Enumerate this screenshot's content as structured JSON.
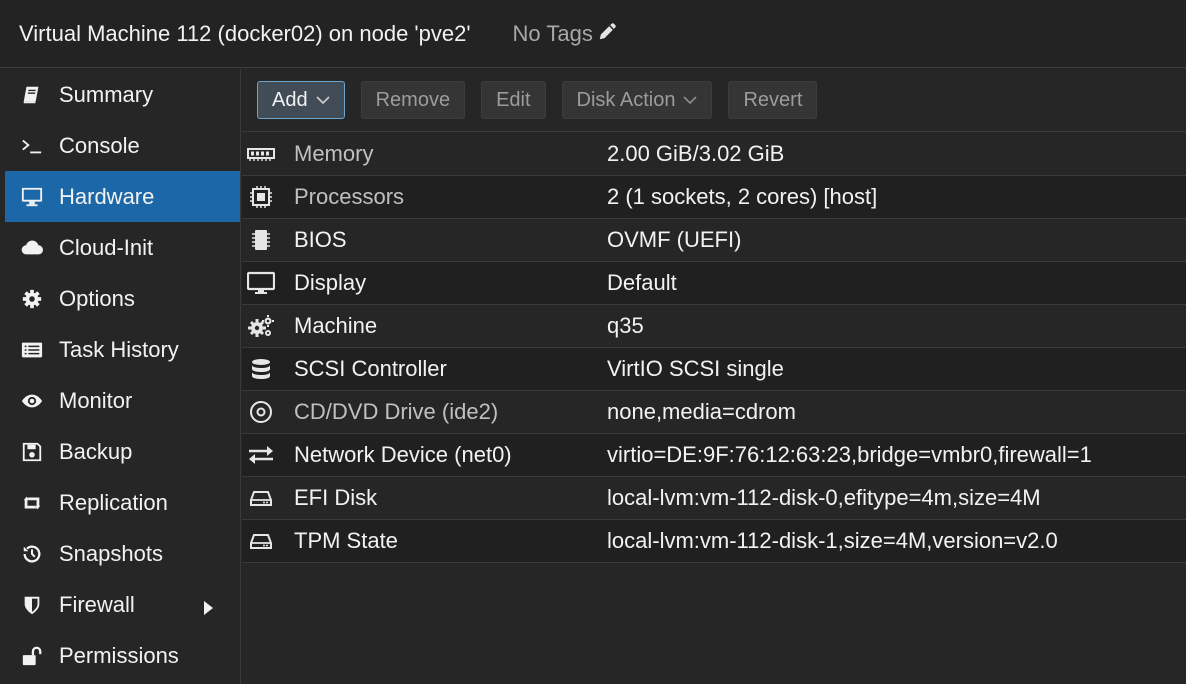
{
  "title_bar": {
    "title": "Virtual Machine 112 (docker02) on node 'pve2'",
    "tags_label": "No Tags",
    "tags_icon": "pencil-icon"
  },
  "sidebar": {
    "items": [
      {
        "label": "Summary",
        "icon": "book-icon",
        "active": false
      },
      {
        "label": "Console",
        "icon": "terminal-icon",
        "active": false
      },
      {
        "label": "Hardware",
        "icon": "monitor-icon",
        "active": true
      },
      {
        "label": "Cloud-Init",
        "icon": "cloud-icon",
        "active": false
      },
      {
        "label": "Options",
        "icon": "gear-icon",
        "active": false
      },
      {
        "label": "Task History",
        "icon": "list-icon",
        "active": false
      },
      {
        "label": "Monitor",
        "icon": "eye-icon",
        "active": false
      },
      {
        "label": "Backup",
        "icon": "floppy-icon",
        "active": false
      },
      {
        "label": "Replication",
        "icon": "retweet-icon",
        "active": false
      },
      {
        "label": "Snapshots",
        "icon": "history-icon",
        "active": false
      },
      {
        "label": "Firewall",
        "icon": "shield-icon",
        "active": false,
        "has_submenu": true
      },
      {
        "label": "Permissions",
        "icon": "unlock-icon",
        "active": false
      }
    ]
  },
  "toolbar": {
    "add_label": "Add",
    "remove_label": "Remove",
    "edit_label": "Edit",
    "disk_action_label": "Disk Action",
    "revert_label": "Revert"
  },
  "hardware": {
    "rows": [
      {
        "name": "Memory",
        "value": "2.00 GiB/3.02 GiB",
        "icon": "memory-icon",
        "dim": true
      },
      {
        "name": "Processors",
        "value": "2 (1 sockets, 2 cores) [host]",
        "icon": "cpu-icon",
        "dim": true
      },
      {
        "name": "BIOS",
        "value": "OVMF (UEFI)",
        "icon": "bios-chip-icon",
        "dim": false
      },
      {
        "name": "Display",
        "value": "Default",
        "icon": "display-icon",
        "dim": false
      },
      {
        "name": "Machine",
        "value": "q35",
        "icon": "cogs-icon",
        "dim": false
      },
      {
        "name": "SCSI Controller",
        "value": "VirtIO SCSI single",
        "icon": "database-icon",
        "dim": false
      },
      {
        "name": "CD/DVD Drive (ide2)",
        "value": "none,media=cdrom",
        "icon": "cdrom-icon",
        "dim": true
      },
      {
        "name": "Network Device (net0)",
        "value": "virtio=DE:9F:76:12:63:23,bridge=vmbr0,firewall=1",
        "icon": "exchange-icon",
        "dim": false
      },
      {
        "name": "EFI Disk",
        "value": "local-lvm:vm-112-disk-0,efitype=4m,size=4M",
        "icon": "hdd-icon",
        "dim": false
      },
      {
        "name": "TPM State",
        "value": "local-lvm:vm-112-disk-1,size=4M,version=v2.0",
        "icon": "hdd-icon",
        "dim": false
      }
    ]
  },
  "colors": {
    "accent": "#1c67a8",
    "background": "#262626",
    "alt_row": "#202020",
    "text": "#f2f2f2",
    "muted_text": "#9c9c9c"
  }
}
